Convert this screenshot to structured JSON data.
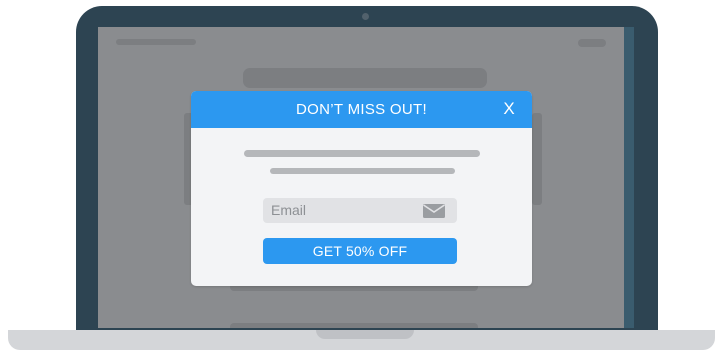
{
  "modal": {
    "title": "DON’T MISS OUT!",
    "close_label": "X",
    "email_placeholder": "Email",
    "cta_label": "GET 50% OFF"
  },
  "icons": {
    "close": "close-icon",
    "email": "envelope-icon"
  },
  "colors": {
    "accent": "#2c98f0",
    "laptop_frame": "#2d4452",
    "screen_overlay": "#8a8c8f",
    "modal_background": "#f3f4f6",
    "input_background": "#e1e2e5",
    "laptop_base": "#d4d6d9"
  }
}
